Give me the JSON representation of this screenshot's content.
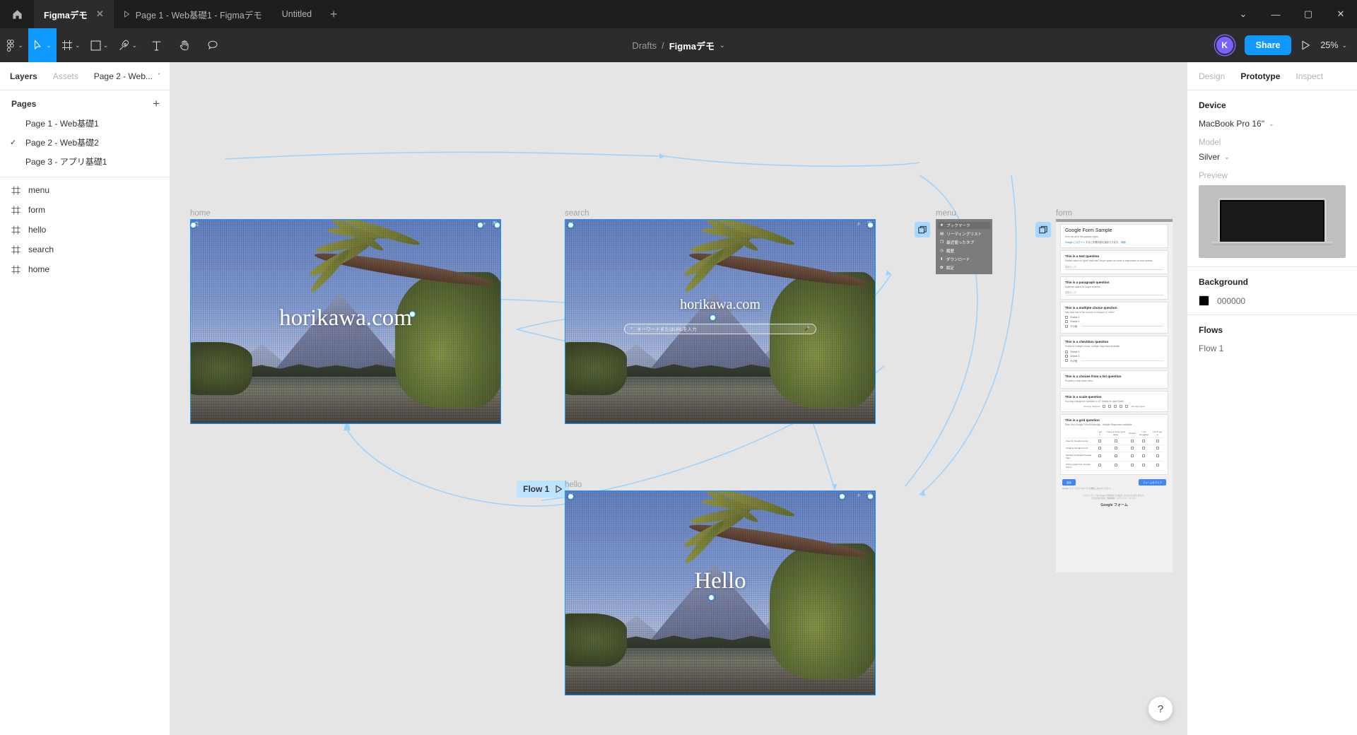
{
  "window": {
    "tabs": [
      {
        "title": "Figmaデモ",
        "active": true,
        "has_close": true,
        "has_play": false
      },
      {
        "title": "Page 1 - Web基礎1 - Figmaデモ",
        "active": false,
        "has_close": false,
        "has_play": true
      },
      {
        "title": "Untitled",
        "active": false,
        "has_close": false,
        "has_play": false
      }
    ],
    "new_tab_label": "+",
    "controls": {
      "menu": "⌄",
      "minimize": "—",
      "maximize": "▢",
      "close": "✕"
    }
  },
  "toolbar": {
    "figma_menu_icon": "figma-logo-icon",
    "tools": [
      {
        "name": "move-tool",
        "icon": "cursor-icon",
        "active": true,
        "has_chevron": true
      },
      {
        "name": "frame-tool",
        "icon": "frame-icon",
        "active": false,
        "has_chevron": true
      },
      {
        "name": "shape-tool",
        "icon": "square-icon",
        "active": false,
        "has_chevron": true
      },
      {
        "name": "pen-tool",
        "icon": "pen-icon",
        "active": false,
        "has_chevron": true
      },
      {
        "name": "text-tool",
        "icon": "text-icon",
        "active": false,
        "has_chevron": false
      },
      {
        "name": "hand-tool",
        "icon": "hand-icon",
        "active": false,
        "has_chevron": false
      },
      {
        "name": "comment-tool",
        "icon": "comment-icon",
        "active": false,
        "has_chevron": false
      }
    ],
    "breadcrumb_project": "Drafts",
    "breadcrumb_separator": "/",
    "breadcrumb_file": "Figmaデモ",
    "avatar_initial": "K",
    "share_label": "Share",
    "present_icon": "play-icon",
    "zoom_level": "25%"
  },
  "left_panel": {
    "tabs": [
      {
        "label": "Layers",
        "active": true
      },
      {
        "label": "Assets",
        "active": false
      }
    ],
    "page_selector": "Page 2 - Web...",
    "pages_heading": "Pages",
    "add_page_label": "+",
    "pages": [
      {
        "label": "Page 1 - Web基礎1",
        "selected": false
      },
      {
        "label": "Page 2 - Web基礎2",
        "selected": true
      },
      {
        "label": "Page 3 - アプリ基礎1",
        "selected": false
      }
    ],
    "layers": [
      {
        "label": "menu",
        "icon": "frame-icon"
      },
      {
        "label": "form",
        "icon": "frame-icon"
      },
      {
        "label": "hello",
        "icon": "frame-icon"
      },
      {
        "label": "search",
        "icon": "frame-icon"
      },
      {
        "label": "home",
        "icon": "frame-icon"
      }
    ]
  },
  "right_panel": {
    "tabs": [
      {
        "label": "Design",
        "active": false
      },
      {
        "label": "Prototype",
        "active": true
      },
      {
        "label": "Inspect",
        "active": false
      }
    ],
    "device_heading": "Device",
    "device_value": "MacBook Pro 16\"",
    "model_label": "Model",
    "model_value": "Silver",
    "preview_label": "Preview",
    "background_heading": "Background",
    "background_hex": "000000",
    "background_color": "#000000",
    "flows_heading": "Flows",
    "flows": [
      "Flow 1"
    ]
  },
  "canvas": {
    "accent_color": "#0d99ff",
    "flow_badge": {
      "label": "Flow 1",
      "icon": "play-icon"
    },
    "frames": [
      {
        "name": "home",
        "title": "horikawa.com"
      },
      {
        "name": "search",
        "title": "horikawa.com",
        "search_placeholder": "キーワードまたはURLを入力"
      },
      {
        "name": "hello",
        "title": "Hello"
      },
      {
        "name": "menu"
      },
      {
        "name": "form"
      }
    ],
    "menu_frame": {
      "items": [
        {
          "label": "ブックマーク",
          "icon": "star-icon",
          "selected": true
        },
        {
          "label": "リーディングリスト",
          "icon": "glasses-icon",
          "selected": false
        },
        {
          "label": "最近使ったタブ",
          "icon": "tabs-icon",
          "selected": false
        },
        {
          "label": "履歴",
          "icon": "history-icon",
          "selected": false
        },
        {
          "label": "ダウンロード",
          "icon": "download-icon",
          "selected": false
        },
        {
          "label": "設定",
          "icon": "gear-icon",
          "selected": false
        }
      ]
    },
    "form_frame": {
      "title": "Google Form Sample",
      "subtitle": "Here are all of the question types.",
      "signin_link": "Google にログイン",
      "signin_rest": "すると作業内容を保存できます。",
      "signin_more": "詳細",
      "questions": [
        {
          "title": "This is a text question",
          "sub": "Limited space for typed response. Ample space for name of respondent or short answer.",
          "type": "text",
          "input_placeholder": "回答を入力"
        },
        {
          "title": "This is a paragraph question",
          "sub": "Unlimited space for longer answers",
          "type": "text",
          "input_placeholder": "回答を入力"
        },
        {
          "title": "This is a multiple choice question",
          "sub": "May click one of the choices or respond to \"other\"",
          "type": "radio",
          "options": [
            "Choice 1",
            "Choice 2",
            "その他"
          ]
        },
        {
          "title": "This is a checkbox question",
          "sub": "Similar to multiple choice, multiple responses available",
          "type": "checkbox",
          "options": [
            "Choice 1",
            "Choice 2",
            "その他"
          ]
        },
        {
          "title": "This is a choose from a list question",
          "sub": "Provides a drop down menu",
          "type": "select"
        },
        {
          "title": "This is a scale question",
          "sub": "You may change the numbers to 10, Similar to Likert Scale",
          "type": "scale",
          "scale_numbers": [
            "1",
            "2",
            "3",
            "4",
            "5"
          ],
          "scale_low": "Strongly disagree",
          "scale_high": "Strongly agree"
        },
        {
          "title": "This is a grid question",
          "sub": "Rate Your Google Form Knowledge - Multiple Responses Available",
          "type": "grid",
          "columns": [
            "I got it",
            "I have a pretty good grasp",
            "Neutral",
            "I am struggling",
            "I don't get it"
          ],
          "rows": [
            "Uses for Google Forms",
            "Creating Google Forms",
            "Sending completed Google Form",
            "Using results from Google Forms"
          ]
        }
      ],
      "submit_label": "送信",
      "clear_label": "フォームをクリア",
      "warning": "Google フォームでパスワードを送信しないでください。",
      "footer_note": "このコンテンツは Google が作成または承認したものではありません。",
      "footer_links": "不正行為の報告 - 利用規約 - プライバシー ポリシー",
      "footer_brand": "Google フォーム"
    }
  },
  "help": {
    "label": "?"
  }
}
